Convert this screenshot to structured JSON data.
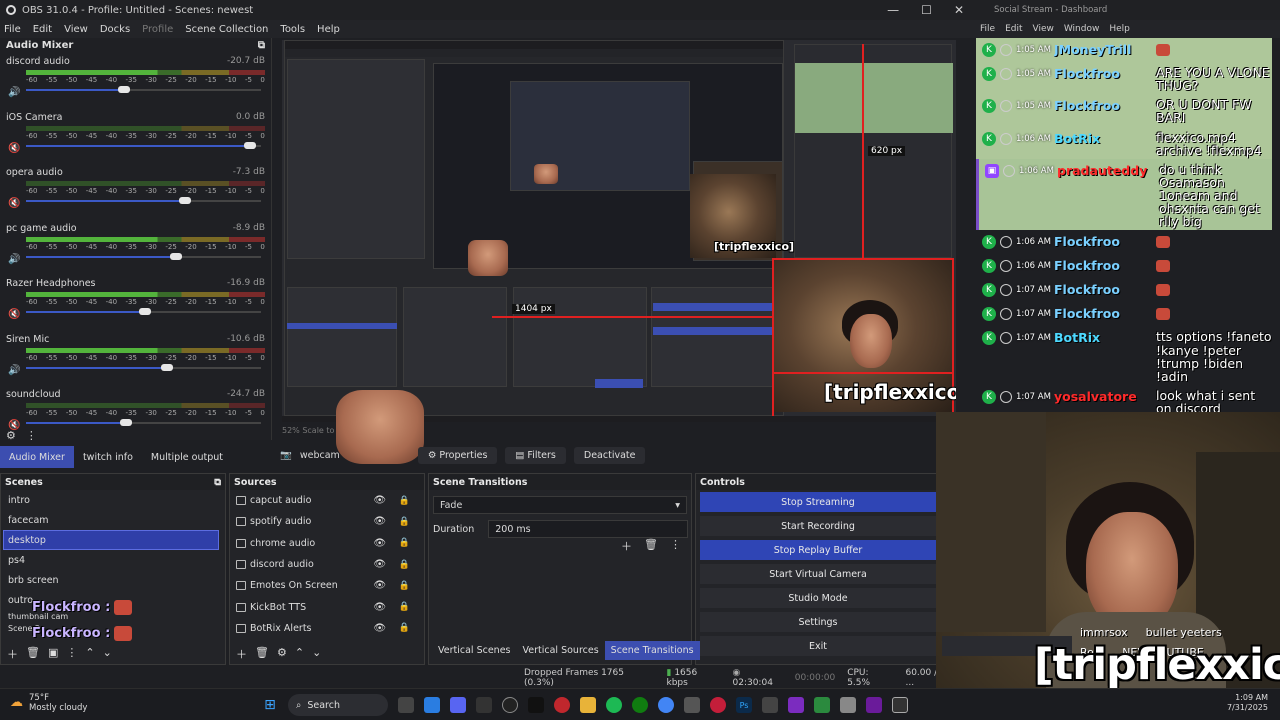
{
  "obs": {
    "title": "OBS 31.0.4 - Profile: Untitled - Scenes: newest",
    "window_controls": [
      "—",
      "☐",
      "✕"
    ],
    "menu": [
      "File",
      "Edit",
      "View",
      "Docks",
      "Profile",
      "Scene Collection",
      "Tools",
      "Help"
    ],
    "mixer": {
      "title": "Audio Mixer",
      "ticks": [
        "-60",
        "-55",
        "-50",
        "-45",
        "-40",
        "-35",
        "-30",
        "-25",
        "-20",
        "-15",
        "-10",
        "-5",
        "0"
      ],
      "channels": [
        {
          "name": "discord audio",
          "db": "-20.7 dB",
          "volume": 0.42,
          "muted": false,
          "live": true
        },
        {
          "name": "iOS Camera",
          "db": "0.0 dB",
          "volume": 1.0,
          "muted": true,
          "live": false
        },
        {
          "name": "opera audio",
          "db": "-7.3 dB",
          "volume": 0.7,
          "muted": true,
          "live": false
        },
        {
          "name": "pc game audio",
          "db": "-8.9 dB",
          "volume": 0.66,
          "muted": false,
          "live": true
        },
        {
          "name": "Razer Headphones",
          "db": "-16.9 dB",
          "volume": 0.52,
          "muted": true,
          "live": true
        },
        {
          "name": "Siren Mic",
          "db": "-10.6 dB",
          "volume": 0.62,
          "muted": false,
          "live": true
        },
        {
          "name": "soundcloud",
          "db": "-24.7 dB",
          "volume": 0.43,
          "muted": true,
          "live": false
        }
      ]
    },
    "preview": {
      "scale_text": "52%   Scale to",
      "selection_size": "1404 px",
      "mini_size": "620 px",
      "tag": "[tripflexxico]"
    },
    "dock_tabs": [
      "Audio Mixer",
      "twitch info",
      "Multiple output"
    ],
    "source_toolbar": {
      "source_name": "webcam",
      "properties": "Properties",
      "filters": "Filters",
      "deactivate": "Deactivate"
    },
    "scenes": {
      "title": "Scenes",
      "items": [
        "intro",
        "facecam",
        "desktop",
        "ps4",
        "brb screen",
        "outro",
        "thumbnail cam",
        "Scene 2"
      ],
      "selected": 2
    },
    "sources": {
      "title": "Sources",
      "items": [
        "capcut audio",
        "spotify audio",
        "chrome audio",
        "discord audio",
        "Emotes On Screen",
        "KickBot TTS",
        "BotRix Alerts"
      ]
    },
    "transitions": {
      "title": "Scene Transitions",
      "type": "Fade",
      "duration_label": "Duration",
      "duration_value": "200 ms"
    },
    "controls": {
      "title": "Controls",
      "buttons": [
        {
          "label": "Stop Streaming",
          "active": true
        },
        {
          "label": "Start Recording",
          "active": false
        },
        {
          "label": "Stop Replay Buffer",
          "active": true
        },
        {
          "label": "Start Virtual Camera",
          "active": false
        },
        {
          "label": "Studio Mode",
          "active": false
        },
        {
          "label": "Settings",
          "active": false
        },
        {
          "label": "Exit",
          "active": false
        }
      ]
    },
    "bottom_tabs": [
      "Vertical Scenes",
      "Vertical Sources",
      "Scene Transitions"
    ],
    "status": {
      "dropped": "Dropped Frames 1765 (0.3%)",
      "bitrate": "1656 kbps",
      "stream_time": "02:30:04",
      "rec_time": "00:00:00",
      "cpu": "CPU: 5.5%",
      "fps": "60.00 / 60.00 ..."
    }
  },
  "social": {
    "title": "Social Stream - Dashboard",
    "menu": [
      "File",
      "Edit",
      "View",
      "Window",
      "Help"
    ],
    "messages": [
      {
        "time": "1:05 AM",
        "user": "JMoneyTrill",
        "text": "",
        "style": "hl"
      },
      {
        "time": "1:05 AM",
        "user": "Flockfroo",
        "text": "ARE YOU A VLONE THUG?",
        "style": "hl"
      },
      {
        "time": "1:05 AM",
        "user": "Flockfroo",
        "text": "OR U DONT FW BARI",
        "style": "hl"
      },
      {
        "time": "1:06 AM",
        "user": "BotRix",
        "text": "flexxico.mp4 archive !flexmp4",
        "style": "hl"
      },
      {
        "time": "1:06 AM",
        "user": "pradauteddy",
        "text": "do u think Osamason 1oneam and ohsxnta can get rlly big",
        "style": "hl2"
      },
      {
        "time": "1:06 AM",
        "user": "Flockfroo",
        "text": "",
        "style": ""
      },
      {
        "time": "1:06 AM",
        "user": "Flockfroo",
        "text": "",
        "style": ""
      },
      {
        "time": "1:07 AM",
        "user": "Flockfroo",
        "text": "",
        "style": ""
      },
      {
        "time": "1:07 AM",
        "user": "Flockfroo",
        "text": "",
        "style": ""
      },
      {
        "time": "1:07 AM",
        "user": "BotRix",
        "text": "tts options !faneto !kanye !peter !trump !biden !adin",
        "style": ""
      },
      {
        "time": "1:07 AM",
        "user": "yosalvatore",
        "text": "look what i sent on discord",
        "style": ""
      }
    ]
  },
  "overlay": {
    "float_names": [
      "Flockfroo :",
      "Flockfroo :"
    ],
    "cam_chat": [
      {
        "user": "immrsox",
        "text": "bullet yeeters"
      },
      {
        "user": "Ro...",
        "text": "NEW YOUTUBE"
      }
    ],
    "brand": "[tripflexxico]"
  },
  "taskbar": {
    "temp": "75°F",
    "weather": "Mostly cloudy",
    "search": "Search",
    "time": "1:09 AM",
    "date": "7/31/2025"
  }
}
